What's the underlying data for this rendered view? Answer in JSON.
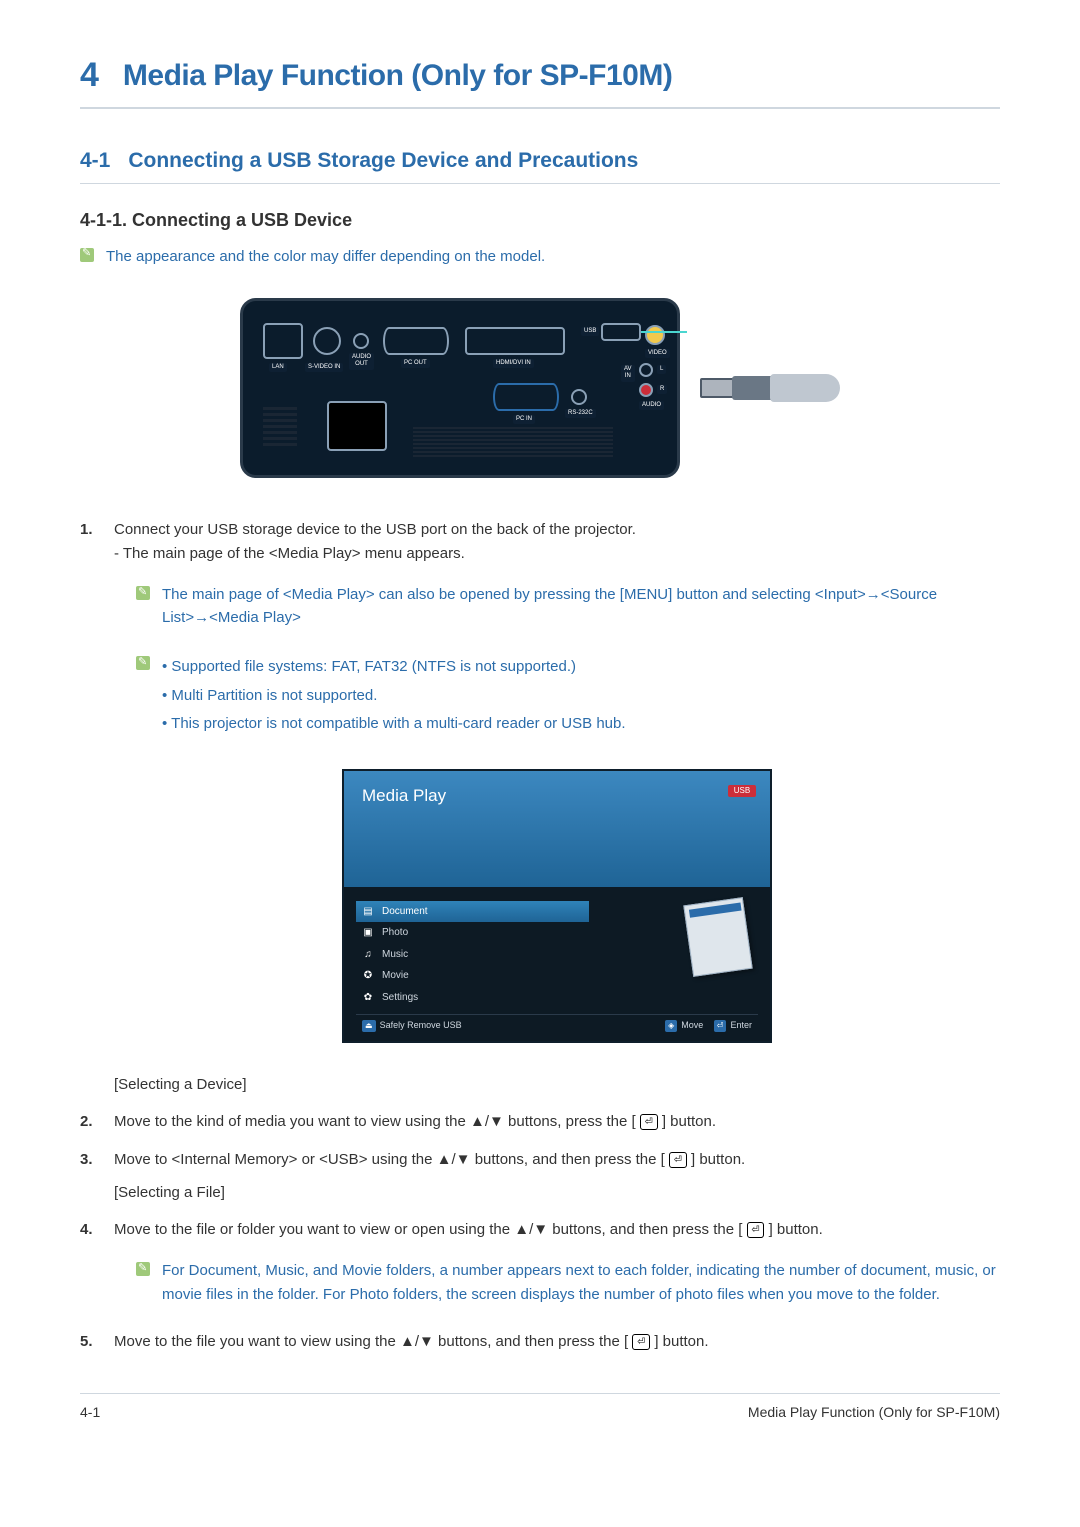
{
  "chapter": {
    "num": "4",
    "title": "Media Play Function (Only for SP-F10M)"
  },
  "section": {
    "num": "4-1",
    "title": "Connecting a USB Storage Device and Precautions"
  },
  "subsection": {
    "title": "4-1-1. Connecting a USB Device"
  },
  "note_color": "The appearance and the color may differ depending on the model.",
  "ports": {
    "lan": "LAN",
    "svideo": "S-VIDEO IN",
    "audio_out": "AUDIO\nOUT",
    "pcout": "PC OUT",
    "hdmi": "HDMI/DVI IN",
    "usb": "USB",
    "video": "VIDEO",
    "avin": "AV\nIN",
    "audio": "AUDIO",
    "rs": "RS-232C",
    "pcin": "PC IN",
    "r": "R",
    "l": "L"
  },
  "steps": {
    "s1_a": "Connect your USB storage device to the USB port on the back of the projector.",
    "s1_b": "- The main page of the <Media Play> menu appears.",
    "note_menu": "The main page of <Media Play> can also be opened by pressing the [MENU] button and selecting  <Input>→<Source List>→<Media Play>",
    "note_fs_1": "Supported file systems: FAT, FAT32 (NTFS is not supported.)",
    "note_fs_2": "Multi Partition is not supported.",
    "note_fs_3": "This projector is not compatible with a multi-card reader or USB hub.",
    "caption_device": "[Selecting a Device]",
    "s2_a": "Move to the kind of media you want to view using the ▲/▼ buttons, press the [",
    "s2_b": "] button.",
    "s3_a": "Move to <Internal Memory> or <USB> using the ▲/▼ buttons, and then press the [",
    "s3_b": "] button.",
    "caption_file": "[Selecting a File]",
    "s4_a": "Move to the file or folder you want to view or open using the ▲/▼ buttons, and then press the [",
    "s4_b": "] button.",
    "note_folder": "For Document, Music, and Movie folders, a number appears next to each folder, indicating the number of document, music, or movie files in the folder. For Photo folders, the screen displays the number of photo files when you move to the folder.",
    "s5_a": "Move to the file you want to view using the ▲/▼ buttons, and then press the [",
    "s5_b": "] button."
  },
  "media_play": {
    "title": "Media Play",
    "usb_badge": "USB",
    "items": {
      "document": "Document",
      "photo": "Photo",
      "music": "Music",
      "movie": "Movie",
      "settings": "Settings"
    },
    "footer": {
      "safe_remove": "Safely Remove USB",
      "move": "Move",
      "enter": "Enter"
    }
  },
  "footer": {
    "left": "4-1",
    "right": "Media Play Function (Only for SP-F10M)"
  },
  "glyph_enter": "⏎"
}
